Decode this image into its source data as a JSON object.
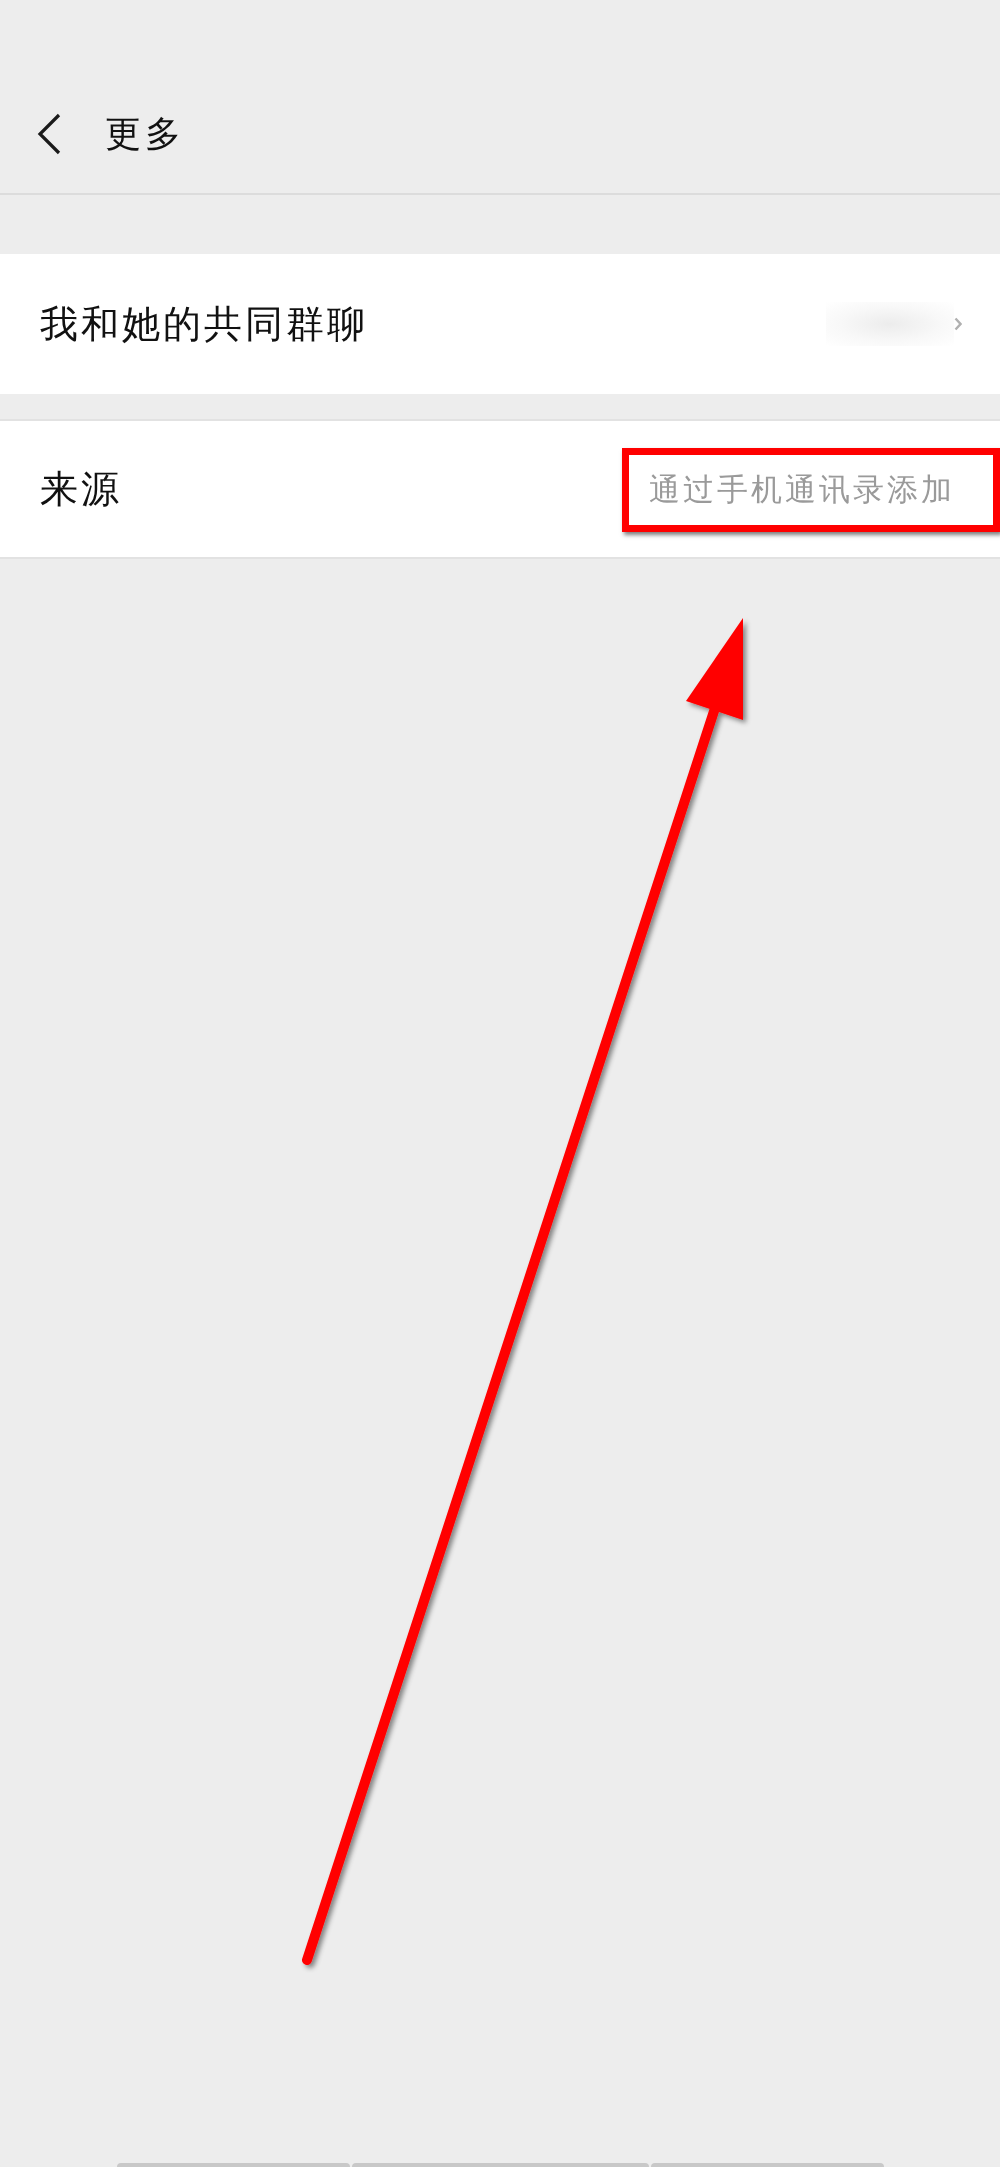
{
  "header": {
    "title": "更多"
  },
  "rows": [
    {
      "kind": "link",
      "label": "我和她的共同群聊",
      "highlighted": false
    },
    {
      "kind": "info",
      "label": "来源",
      "value": "通过手机通讯录添加",
      "highlighted": true
    }
  ]
}
